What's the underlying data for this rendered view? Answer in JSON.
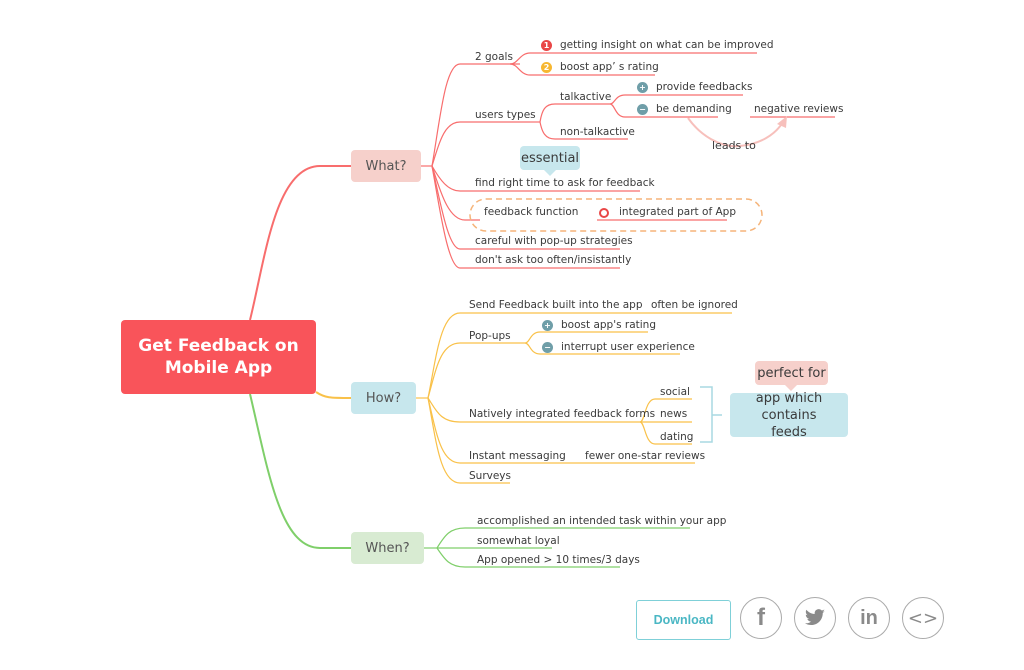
{
  "colors": {
    "root": "#f9545a",
    "what_branch": "#f86d6d",
    "how_branch": "#f9c149",
    "when_branch": "#7fcf6a",
    "accent_teal": "#4ab7c4"
  },
  "root": {
    "label_line1": "Get Feedback on",
    "label_line2": "Mobile App"
  },
  "what": {
    "label": "What?",
    "goals": {
      "label": "2 goals",
      "items": [
        {
          "marker": "1",
          "label": "getting insight on what can be improved"
        },
        {
          "marker": "2",
          "label": "boost app’ s rating"
        }
      ]
    },
    "user_types": {
      "label": "users types",
      "talkactive": {
        "label": "talkactive",
        "items": [
          {
            "marker": "plus-icon",
            "label": "provide feedbacks"
          },
          {
            "marker": "minus-icon",
            "label": "be demanding"
          }
        ],
        "result": "negative reviews",
        "relationship": "leads to"
      },
      "non_talkactive": "non-talkactive"
    },
    "callout_essential": "essential",
    "find_right_time": "find right time to ask for feedback",
    "feedback_function": "feedback function",
    "integrated_part": "integrated part of App",
    "careful": "careful with pop-up strategies",
    "dont_ask": "don't ask too often/insistantly"
  },
  "how": {
    "label": "How?",
    "send_feedback": "Send Feedback built into the app",
    "often_ignored": "often be ignored",
    "popups": {
      "label": "Pop-ups",
      "items": [
        {
          "marker": "plus-icon",
          "label": "boost app's rating"
        },
        {
          "marker": "minus-icon",
          "label": "interrupt user experience"
        }
      ]
    },
    "native_forms": {
      "label": "Natively integrated feedback forms",
      "items": [
        "social",
        "news",
        "dating"
      ],
      "summary": "app which contains feeds",
      "summary_line1": "app which contains",
      "summary_line2": "feeds",
      "callout": "perfect for"
    },
    "instant_messaging": "Instant messaging",
    "fewer_reviews": "fewer one-star reviews",
    "surveys": "Surveys"
  },
  "when": {
    "label": "When?",
    "items": [
      "accomplished an intended task within your app",
      "somewhat loyal",
      "App opened > 10 times/3 days"
    ]
  },
  "footer": {
    "download_label": "Download",
    "share_icons": [
      "facebook-icon",
      "twitter-icon",
      "linkedin-icon",
      "embed-icon"
    ]
  }
}
